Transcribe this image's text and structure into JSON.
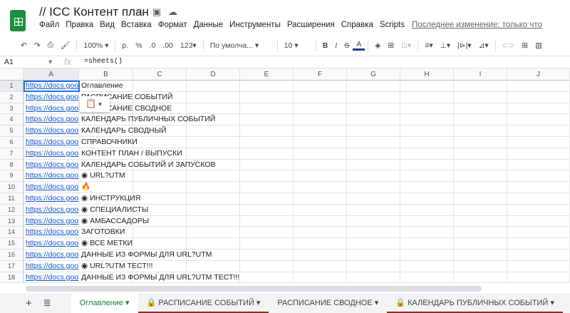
{
  "doc": {
    "title": "// ICC Контент план",
    "last_edit": "Последнее изменение: только что"
  },
  "menu": [
    "Файл",
    "Правка",
    "Вид",
    "Вставка",
    "Формат",
    "Данные",
    "Инструменты",
    "Расширения",
    "Справка",
    "Scripts"
  ],
  "toolbar": {
    "zoom": "100% ▾",
    "currency": "р.",
    "percent": "%",
    "dec_less": ".0",
    "dec_more": ".00",
    "format": "123▾",
    "font": "По умолча... ▾",
    "size": "10 ▾",
    "bold": "B",
    "italic": "I",
    "strike": "S",
    "color": "A"
  },
  "formula_bar": {
    "cell": "A1",
    "fx": "fx",
    "formula": "=sheets()"
  },
  "columns": [
    "A",
    "B",
    "C",
    "D",
    "E",
    "F",
    "G",
    "H",
    "I",
    "J"
  ],
  "rows": [
    {
      "n": "1",
      "a": "https://docs.goog",
      "b": "Оглавление"
    },
    {
      "n": "2",
      "a": "https://docs.goog",
      "b": "РАСПИСАНИЕ СОБЫТИЙ"
    },
    {
      "n": "3",
      "a": "https://docs.goog",
      "b": "РАСПИСАНИЕ СВОДНОЕ"
    },
    {
      "n": "4",
      "a": "https://docs.goog",
      "b": "КАЛЕНДАРЬ ПУБЛИЧНЫХ СОБЫТИЙ"
    },
    {
      "n": "5",
      "a": "https://docs.goog",
      "b": "КАЛЕНДАРЬ СВОДНЫЙ"
    },
    {
      "n": "6",
      "a": "https://docs.goog",
      "b": "СПРАВОЧНИКИ"
    },
    {
      "n": "7",
      "a": "https://docs.goog",
      "b": "КОНТЕНТ ПЛАН / ВЫПУСКИ"
    },
    {
      "n": "8",
      "a": "https://docs.goog",
      "b": "КАЛЕНДАРЬ СОБЫТИЙ И ЗАПУСКОВ"
    },
    {
      "n": "9",
      "a": "https://docs.goog",
      "b": "◉ URL?UTM"
    },
    {
      "n": "10",
      "a": "https://docs.goog",
      "b": "🔥"
    },
    {
      "n": "11",
      "a": "https://docs.goog",
      "b": "◉ ИНСТРУКЦИЯ"
    },
    {
      "n": "12",
      "a": "https://docs.goog",
      "b": "◉ СПЕЦИАЛИСТЫ"
    },
    {
      "n": "13",
      "a": "https://docs.goog",
      "b": "◉ АМБАССАДОРЫ"
    },
    {
      "n": "14",
      "a": "https://docs.goog",
      "b": "ЗАГОТОВКИ"
    },
    {
      "n": "15",
      "a": "https://docs.goog",
      "b": "◉ ВСЕ МЕТКИ"
    },
    {
      "n": "16",
      "a": "https://docs.goog",
      "b": "ДАННЫЕ ИЗ ФОРМЫ ДЛЯ URL?UTM"
    },
    {
      "n": "17",
      "a": "https://docs.goog",
      "b": "◉ URL?UTM ТЕСТ!!!"
    },
    {
      "n": "18",
      "a": "https://docs.goog",
      "b": "ДАННЫЕ ИЗ ФОРМЫ ДЛЯ URL?UTM ТЕСТ!!!"
    }
  ],
  "sheet_tabs": [
    {
      "label": "Оглавление ▾",
      "locked": false
    },
    {
      "label": "РАСПИСАНИЕ СОБЫТИЙ ▾",
      "locked": true
    },
    {
      "label": "РАСПИСАНИЕ СВОДНОЕ ▾",
      "locked": false
    },
    {
      "label": "КАЛЕНДАРЬ ПУБЛИЧНЫХ СОБЫТИЙ ▾",
      "locked": true
    }
  ]
}
